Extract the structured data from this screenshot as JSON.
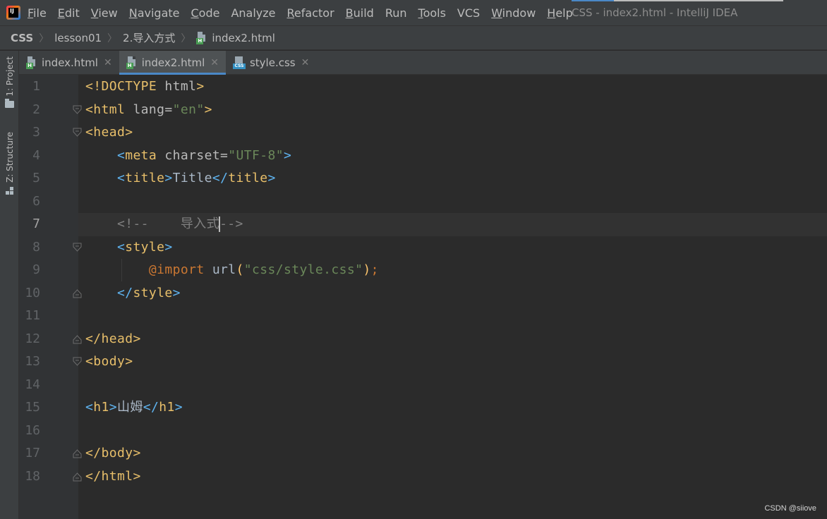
{
  "menubar": {
    "items": [
      {
        "label": "File",
        "mnemonic": "F",
        "rest": "ile"
      },
      {
        "label": "Edit",
        "mnemonic": "E",
        "rest": "dit"
      },
      {
        "label": "View",
        "mnemonic": "V",
        "rest": "iew"
      },
      {
        "label": "Navigate",
        "mnemonic": "N",
        "rest": "avigate"
      },
      {
        "label": "Code",
        "mnemonic": "C",
        "rest": "ode"
      },
      {
        "label": "Analyze",
        "mnemonic": "",
        "rest": "Analyze"
      },
      {
        "label": "Refactor",
        "mnemonic": "R",
        "rest": "efactor"
      },
      {
        "label": "Build",
        "mnemonic": "B",
        "rest": "uild"
      },
      {
        "label": "Run",
        "mnemonic": "",
        "rest": "Run"
      },
      {
        "label": "Tools",
        "mnemonic": "T",
        "rest": "ools"
      },
      {
        "label": "VCS",
        "mnemonic": "",
        "rest": "VCS"
      },
      {
        "label": "Window",
        "mnemonic": "W",
        "rest": "indow"
      },
      {
        "label": "Help",
        "mnemonic": "H",
        "rest": "elp"
      }
    ],
    "window_title": "CSS - index2.html - IntelliJ IDEA"
  },
  "breadcrumb": {
    "project": "CSS",
    "folder1": "lesson01",
    "folder2": "2.导入方式",
    "file": "index2.html"
  },
  "toolstrip": {
    "project_label": "1: Project",
    "structure_label": "Z: Structure"
  },
  "tabs": [
    {
      "label": "index.html",
      "type": "html",
      "active": false
    },
    {
      "label": "index2.html",
      "type": "html",
      "active": true
    },
    {
      "label": "style.css",
      "type": "css",
      "active": false
    }
  ],
  "editor": {
    "current_line": 7,
    "line_numbers": [
      "1",
      "2",
      "3",
      "4",
      "5",
      "6",
      "7",
      "8",
      "9",
      "10",
      "11",
      "12",
      "13",
      "14",
      "15",
      "16",
      "17",
      "18"
    ],
    "lines": {
      "l1": {
        "a": "<!DOCTYPE",
        "b": " html",
        "c": ">"
      },
      "l2": {
        "open": "<",
        "tag": "html",
        "attr": " lang=",
        "val": "\"en\"",
        "close": ">"
      },
      "l3": {
        "open": "<",
        "tag": "head",
        "close": ">"
      },
      "l4": {
        "indent": "    ",
        "open": "<",
        "tag": "meta",
        "attr": " charset=",
        "val": "\"UTF-8\"",
        "close": ">"
      },
      "l5": {
        "indent": "    ",
        "open": "<",
        "tag": "title",
        "close": ">",
        "text": "Title",
        "open2": "</",
        "tag2": "title",
        "close2": ">"
      },
      "l7": {
        "indent": "    ",
        "comment_a": "<!--    导入式",
        "comment_b": "-->"
      },
      "l8": {
        "indent": "    ",
        "open": "<",
        "tag": "style",
        "close": ">"
      },
      "l9": {
        "indent": "        ",
        "at": "@import",
        "fn": " url",
        "p1": "(",
        "str": "\"css/style.css\"",
        "p2": ")",
        "semi": ";"
      },
      "l10": {
        "indent": "    ",
        "open": "</",
        "tag": "style",
        "close": ">"
      },
      "l12": {
        "open": "</",
        "tag": "head",
        "close": ">"
      },
      "l13": {
        "open": "<",
        "tag": "body",
        "close": ">"
      },
      "l15": {
        "open": "<",
        "tag": "h1",
        "close": ">",
        "text": "山姆",
        "open2": "</",
        "tag2": "h1",
        "close2": ">"
      },
      "l17": {
        "open": "</",
        "tag": "body",
        "close": ">"
      },
      "l18": {
        "open": "</",
        "tag": "html",
        "close": ">"
      }
    }
  },
  "watermark": "CSDN @siiove",
  "colors": {
    "background": "#2b2b2b",
    "gutter": "#313335",
    "chrome": "#3c3f41",
    "tag": "#e8bf6a",
    "bracket": "#5fb4f0",
    "string": "#6a8759",
    "comment": "#808080",
    "keyword": "#cc7832",
    "function": "#ffc66d",
    "accent": "#4a88c7"
  },
  "icons": [
    "intellij-logo-icon",
    "html-file-icon",
    "css-file-icon",
    "close-icon",
    "folder-icon",
    "structure-icon",
    "fold-marker-icon"
  ]
}
